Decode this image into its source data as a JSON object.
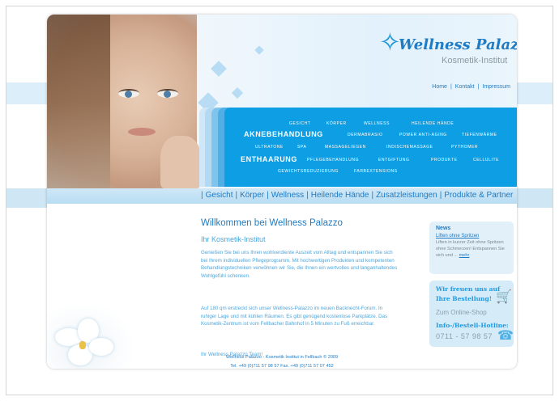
{
  "brand": {
    "title": "Wellness Palazzo",
    "subtitle": "Kosmetik-Institut",
    "logo_icon": "figure-icon",
    "accent": "#1f7bc4",
    "menu_blue": "#0d9ee3"
  },
  "top_links": [
    "Home",
    "Kontakt",
    "Impressum"
  ],
  "top_link_sep": "|",
  "treatment_menu": {
    "row1": [
      "GESICHT",
      "KÖRPER",
      "WELLNESS",
      "HEILENDE HÄNDE"
    ],
    "row2_big": "AKNEBEHANDLUNG",
    "row2": [
      "DERMABRASIO",
      "POWER ANTI-AGING",
      "TIEFENWÄRME"
    ],
    "row3": [
      "ULTRATONE",
      "SPA",
      "MASSAGELIEGEN",
      "INDISCHEMASSAGE",
      "PYTHOMER"
    ],
    "row4_big": "ENTHAARUNG",
    "row4": [
      "PFLEGEBEHANDLUNG",
      "ENTGIFTUNG",
      "PRODUKTE",
      "CELLULITE"
    ],
    "row5": [
      "GEWICHTSREDUZIERUNG",
      "FARBEXTENSIONS"
    ]
  },
  "main_nav": [
    "Gesicht",
    "Körper",
    "Wellness",
    "Heilende Hände",
    "Zusatzleistungen",
    "Produkte & Partner"
  ],
  "main_nav_sep": "|",
  "content": {
    "heading": "Willkommen bei Wellness Palazzo",
    "subheading": "Ihr Kosmetik-Institut",
    "para1": "Genießen Sie bei uns Ihren wohlverdiente Auszeit vom Alltag und entspannen Sie sich bei Ihrem individuellen Pflegeprogramm. Mit hochwertigen Produkten und kompetenten Behandlungstechniken verwöhnen wir Sie, die Ihnen ein wertvolles und langanhaltendes Wohlgefühl schenken.",
    "para2": "Auf 180 qm erstreckt sich unser Wellness-Palazzo im neuen Backnecht-Forum. In ruhiger Lage und mit kühlen Räumen. Es gibt genügend kostenlose Parkplätze. Das Kosmetik-Zentrum ist vom Fellbacher Bahnhof in 5 Minuten zu Fuß erreichbar.",
    "signature": "Ihr Wellness Palazzo Team!"
  },
  "news": {
    "title": "News",
    "link": "Liften ohne Spritzen",
    "text": "Liften in kurzer Zeit ohne Spritzen ohne Schmerzen! Entspannen Sie sich und ...",
    "more": "mehr"
  },
  "shop": {
    "line1": "Wir freuen uns auf",
    "line2": "Ihre Bestellung!",
    "link": "Zum Online-Shop",
    "hotline_label": "Info-/Bestell-Hotline:",
    "phone": "0711 - 57 98 57",
    "cart_icon": "shopping-cart-icon",
    "phone_icon": "telephone-icon"
  },
  "footer": {
    "line1": "Wellness Palazzo - Kosmetik Institut in Fellbach  © 2009",
    "line2": "Tel. +49 (0)711 57 98 57     Fax. +49 (0)711 57 07 452"
  }
}
